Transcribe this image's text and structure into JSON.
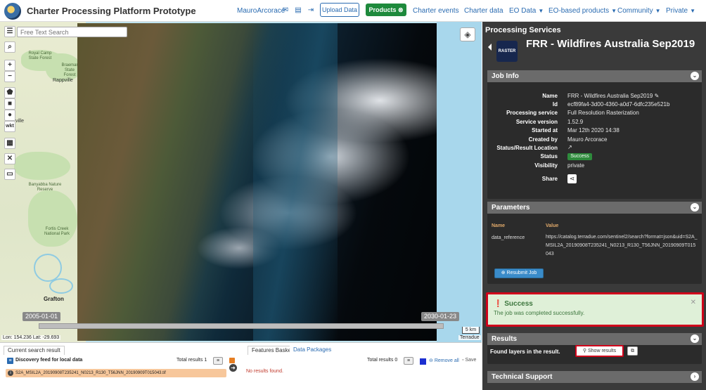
{
  "navbar": {
    "title": "Charter Processing Platform Prototype",
    "user": "MauroArcorace",
    "upload_label": "Upload Data",
    "products_label": "Products",
    "menu": [
      {
        "label": "Charter events",
        "caret": false
      },
      {
        "label": "Charter data",
        "caret": false
      },
      {
        "label": "EO Data",
        "caret": true
      },
      {
        "label": "EO-based products",
        "caret": true
      },
      {
        "label": "Community",
        "caret": true
      },
      {
        "label": "Private",
        "caret": true
      }
    ]
  },
  "map": {
    "search_placeholder": "Free Text Search",
    "wkt_label": "wkt",
    "places": [
      "Royal Camp State Forest",
      "Braemar State Forest",
      "Rappville",
      "Banyabba Nature Reserve",
      "Fortis Creek National Park",
      "Grafton",
      "ville"
    ],
    "time_start": "2005-01-01",
    "time_end": "2030-01-23",
    "scale": "5 km",
    "coords": "Lon: 154.236 Lat: -29.693",
    "attribution": "Terradue"
  },
  "bottom": {
    "tab_current": "Current search result",
    "feed_label": "Discovery feed for local data",
    "total_left_label": "Total results",
    "total_left_value": "1",
    "result_item": "S2A_MSIL2A_20190908T235241_N0213_R130_T56JNN_20190909T015043.tif",
    "tab_basket": "Features Basket",
    "tab_packages": "Data Packages",
    "total_right_label": "Total results",
    "total_right_value": "0",
    "remove_all": "Remove all",
    "save": "Save",
    "no_results": "No results found."
  },
  "panel": {
    "header": "Processing Services",
    "badge": "RASTER",
    "job_title": "FRR - Wildfires Australia Sep2019",
    "job_info": {
      "title": "Job Info",
      "name_label": "Name",
      "name": "FRR - Wildfires Australia Sep2019",
      "id_label": "Id",
      "id": "ecf89fa4-3d00-4360-a0d7-6dfc235e521b",
      "service_label": "Processing service",
      "service": "Full Resolution Rasterization",
      "version_label": "Service version",
      "version": "1.52.9",
      "started_label": "Started at",
      "started": "Mar 12th 2020 14:38",
      "created_label": "Created by",
      "created": "Mauro Arcorace",
      "location_label": "Status/Result Location",
      "status_label": "Status",
      "status": "Success",
      "visibility_label": "Visibility",
      "visibility": "private",
      "share_label": "Share"
    },
    "parameters": {
      "title": "Parameters",
      "col_name": "Name",
      "col_value": "Value",
      "name": "data_reference",
      "value": "https://catalog.terradue.com/sentinel2/search?format=json&uid=S2A_MSIL2A_20190908T235241_N0213_R130_T56JNN_20190909T015043",
      "resubmit": "Resubmit Job"
    },
    "alert": {
      "title": "Success",
      "message": "The job was completed successfully."
    },
    "results": {
      "title": "Results",
      "found": "Found layers in the result.",
      "show": "Show results"
    },
    "support": {
      "title": "Technical Support"
    }
  }
}
